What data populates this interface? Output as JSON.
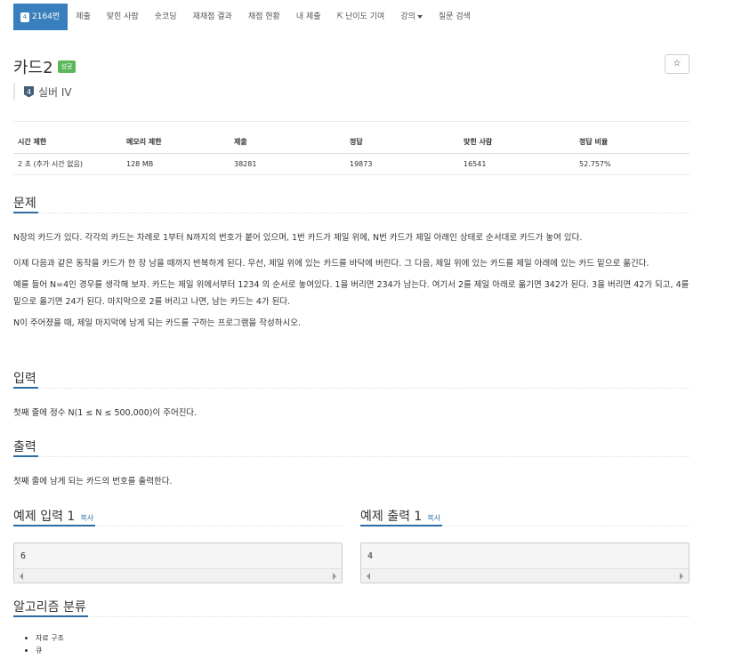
{
  "nav": {
    "problem_number": "2164번",
    "tier_digit": "4",
    "items": [
      "제출",
      "맞힌 사람",
      "숏코딩",
      "재채점 결과",
      "채점 현황",
      "내 제출",
      "난이도 기여",
      "강의",
      "질문 검색"
    ]
  },
  "problem": {
    "title": "카드2",
    "status_badge": "성공",
    "star": "☆",
    "tier_label": "실버 IV",
    "tier_digit": "4"
  },
  "stats": {
    "headers": [
      "시간 제한",
      "메모리 제한",
      "제출",
      "정답",
      "맞힌 사람",
      "정답 비율"
    ],
    "values": [
      "2 초 (추가 시간 없음)",
      "128 MB",
      "38281",
      "19873",
      "16541",
      "52.757%"
    ]
  },
  "sections": {
    "problem_title": "문제",
    "problem_paragraphs": [
      "N장의 카드가 있다. 각각의 카드는 차례로 1부터 N까지의 번호가 붙어 있으며, 1번 카드가 제일 위에, N번 카드가 제일 아래인 상태로 순서대로 카드가 놓여 있다.",
      "이제 다음과 같은 동작을 카드가 한 장 남을 때까지 반복하게 된다. 우선, 제일 위에 있는 카드를 바닥에 버린다. 그 다음, 제일 위에 있는 카드를 제일 아래에 있는 카드 밑으로 옮긴다.",
      "예를 들어 N=4인 경우를 생각해 보자. 카드는 제일 위에서부터 1234 의 순서로 놓여있다. 1을 버리면 234가 남는다. 여기서 2를 제일 아래로 옮기면 342가 된다. 3을 버리면 42가 되고, 4를 밑으로 옮기면 24가 된다. 마지막으로 2를 버리고 나면, 남는 카드는 4가 된다.",
      "N이 주어졌을 때, 제일 마지막에 남게 되는 카드를 구하는 프로그램을 작성하시오."
    ],
    "input_title": "입력",
    "input_text": "첫째 줄에 정수 N(1 ≤ N ≤ 500,000)이 주어진다.",
    "output_title": "출력",
    "output_text": "첫째 줄에 남게 되는 카드의 번호를 출력한다.",
    "sample_input_title": "예제 입력 1",
    "sample_input_copy": "복사",
    "sample_input_value": "6",
    "sample_output_title": "예제 출력 1",
    "sample_output_copy": "복사",
    "sample_output_value": "4",
    "algo_title": "알고리즘 분류",
    "algo_items": [
      "자료 구조",
      "큐"
    ]
  },
  "colors": {
    "nav_active": "#3a7fbd",
    "success_badge": "#5cb85c",
    "heading_underline": "#2d6ca2",
    "tier_silver": "#435f7a"
  }
}
